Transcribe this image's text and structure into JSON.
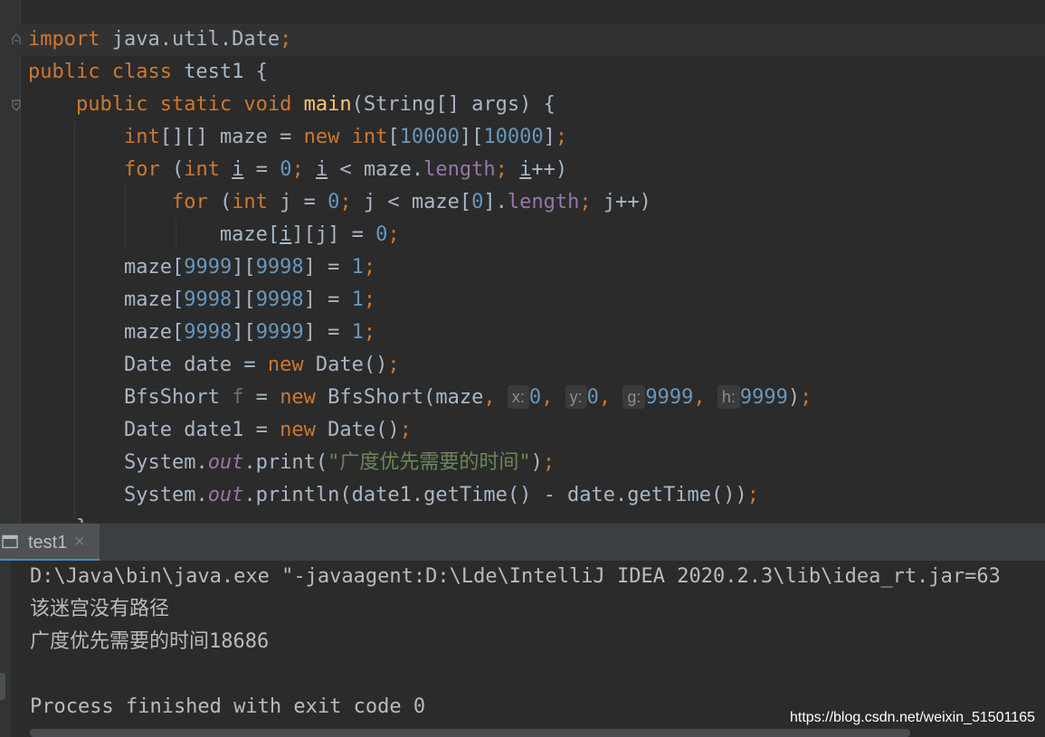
{
  "editor": {
    "lines": [
      [
        {
          "t": "import ",
          "c": "kw"
        },
        {
          "t": "java.util.Date"
        },
        {
          "t": ";",
          "c": "kw"
        }
      ],
      [
        {
          "t": "public class ",
          "c": "kw"
        },
        {
          "t": "test1 {"
        }
      ],
      [
        {
          "t": "    "
        },
        {
          "t": "public static void ",
          "c": "kw"
        },
        {
          "t": "main",
          "c": "fn"
        },
        {
          "t": "(String[] args) {"
        }
      ],
      [
        {
          "t": "        "
        },
        {
          "t": "int",
          "c": "kw"
        },
        {
          "t": "[][] maze = "
        },
        {
          "t": "new ",
          "c": "kw"
        },
        {
          "t": "int",
          "c": "kw"
        },
        {
          "t": "["
        },
        {
          "t": "10000",
          "c": "num"
        },
        {
          "t": "]["
        },
        {
          "t": "10000",
          "c": "num"
        },
        {
          "t": "]"
        },
        {
          "t": ";",
          "c": "kw"
        }
      ],
      [
        {
          "t": "        "
        },
        {
          "t": "for ",
          "c": "kw"
        },
        {
          "t": "("
        },
        {
          "t": "int ",
          "c": "kw"
        },
        {
          "t": "i",
          "c": "ul"
        },
        {
          "t": " = "
        },
        {
          "t": "0",
          "c": "num"
        },
        {
          "t": "; ",
          "c": "kw"
        },
        {
          "t": "i",
          "c": "ul"
        },
        {
          "t": " < maze."
        },
        {
          "t": "length",
          "c": "fld"
        },
        {
          "t": "; ",
          "c": "kw"
        },
        {
          "t": "i",
          "c": "ul"
        },
        {
          "t": "++)"
        }
      ],
      [
        {
          "t": "            "
        },
        {
          "t": "for ",
          "c": "kw"
        },
        {
          "t": "("
        },
        {
          "t": "int ",
          "c": "kw"
        },
        {
          "t": "j = "
        },
        {
          "t": "0",
          "c": "num"
        },
        {
          "t": "; ",
          "c": "kw"
        },
        {
          "t": "j < maze["
        },
        {
          "t": "0",
          "c": "num"
        },
        {
          "t": "]."
        },
        {
          "t": "length",
          "c": "fld"
        },
        {
          "t": "; ",
          "c": "kw"
        },
        {
          "t": "j++)"
        }
      ],
      [
        {
          "t": "                "
        },
        {
          "t": "maze["
        },
        {
          "t": "i",
          "c": "ul"
        },
        {
          "t": "][j] = "
        },
        {
          "t": "0",
          "c": "num"
        },
        {
          "t": ";",
          "c": "kw"
        }
      ],
      [
        {
          "t": "        "
        },
        {
          "t": "maze["
        },
        {
          "t": "9999",
          "c": "num"
        },
        {
          "t": "]["
        },
        {
          "t": "9998",
          "c": "num"
        },
        {
          "t": "] = "
        },
        {
          "t": "1",
          "c": "num"
        },
        {
          "t": ";",
          "c": "kw"
        }
      ],
      [
        {
          "t": "        "
        },
        {
          "t": "maze["
        },
        {
          "t": "9998",
          "c": "num"
        },
        {
          "t": "]["
        },
        {
          "t": "9998",
          "c": "num"
        },
        {
          "t": "] = "
        },
        {
          "t": "1",
          "c": "num"
        },
        {
          "t": ";",
          "c": "kw"
        }
      ],
      [
        {
          "t": "        "
        },
        {
          "t": "maze["
        },
        {
          "t": "9998",
          "c": "num"
        },
        {
          "t": "]["
        },
        {
          "t": "9999",
          "c": "num"
        },
        {
          "t": "] = "
        },
        {
          "t": "1",
          "c": "num"
        },
        {
          "t": ";",
          "c": "kw"
        }
      ],
      [
        {
          "t": "        "
        },
        {
          "t": "Date date = "
        },
        {
          "t": "new ",
          "c": "kw"
        },
        {
          "t": "Date()"
        },
        {
          "t": ";",
          "c": "kw"
        }
      ],
      [
        {
          "t": "        "
        },
        {
          "t": "BfsShort "
        },
        {
          "t": "f",
          "c": "unused"
        },
        {
          "t": " = "
        },
        {
          "t": "new ",
          "c": "kw"
        },
        {
          "t": "BfsShort(maze"
        },
        {
          "t": ", ",
          "c": "kw"
        },
        {
          "t": "x:",
          "c": "hint"
        },
        {
          "t": "0",
          "c": "num"
        },
        {
          "t": ", ",
          "c": "kw"
        },
        {
          "t": "y:",
          "c": "hint"
        },
        {
          "t": "0",
          "c": "num"
        },
        {
          "t": ", ",
          "c": "kw"
        },
        {
          "t": "g:",
          "c": "hint"
        },
        {
          "t": "9999",
          "c": "num"
        },
        {
          "t": ", ",
          "c": "kw"
        },
        {
          "t": "h:",
          "c": "hint"
        },
        {
          "t": "9999",
          "c": "num"
        },
        {
          "t": ")"
        },
        {
          "t": ";",
          "c": "kw"
        }
      ],
      [
        {
          "t": "        "
        },
        {
          "t": "Date date1 = "
        },
        {
          "t": "new ",
          "c": "kw"
        },
        {
          "t": "Date()"
        },
        {
          "t": ";",
          "c": "kw"
        }
      ],
      [
        {
          "t": "        "
        },
        {
          "t": "System."
        },
        {
          "t": "out",
          "c": "sfld"
        },
        {
          "t": ".print("
        },
        {
          "t": "\"广度优先需要的时间\"",
          "c": "str"
        },
        {
          "t": ")"
        },
        {
          "t": ";",
          "c": "kw"
        }
      ],
      [
        {
          "t": "        "
        },
        {
          "t": "System."
        },
        {
          "t": "out",
          "c": "sfld"
        },
        {
          "t": ".println(date1.getTime() - date.getTime())"
        },
        {
          "t": ";",
          "c": "kw"
        }
      ],
      [
        {
          "t": "    }"
        }
      ]
    ]
  },
  "run_panel": {
    "tab_label": "test1",
    "close_glyph": "×"
  },
  "console": {
    "lines": [
      "D:\\Java\\bin\\java.exe \"-javaagent:D:\\Lde\\IntelliJ IDEA 2020.2.3\\lib\\idea_rt.jar=63",
      "该迷宫没有路径",
      "广度优先需要的时间18686",
      "",
      "Process finished with exit code 0"
    ]
  },
  "watermark": "https://blog.csdn.net/weixin_51501165"
}
